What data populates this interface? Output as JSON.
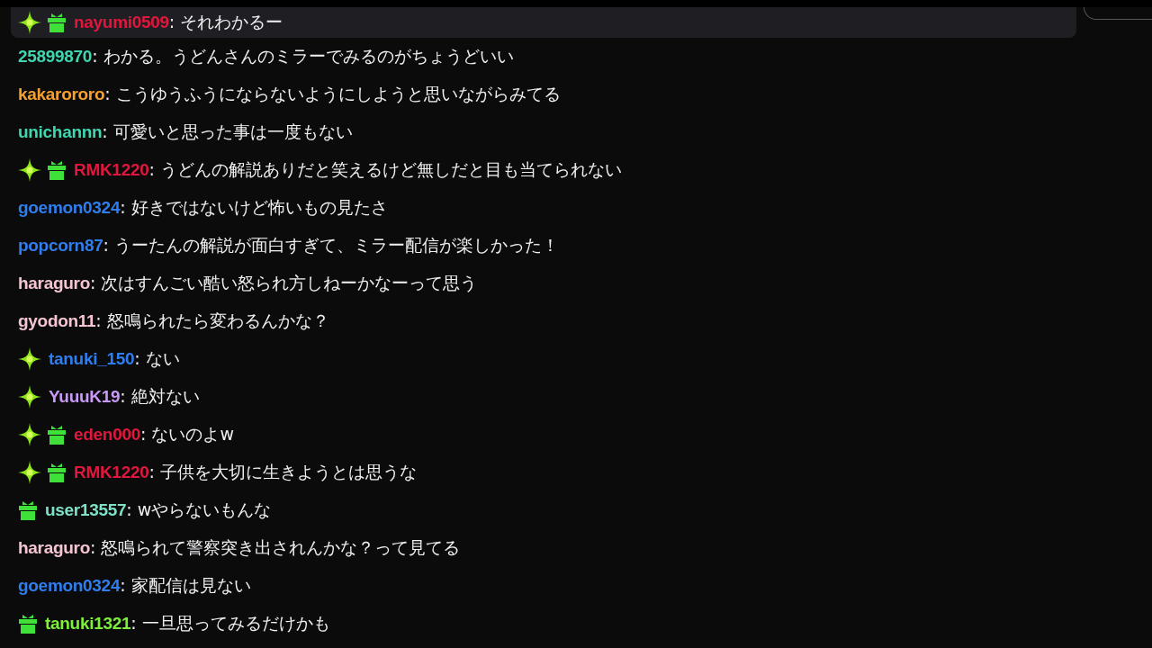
{
  "messages": [
    {
      "user": "nayumi0509",
      "color": "#e0173d",
      "sparkle_badge": true,
      "gift_badge": true,
      "text": ": それわかるー",
      "highlighted": true
    },
    {
      "user": "25899870",
      "color": "#3fd6b0",
      "sparkle_badge": false,
      "gift_badge": false,
      "text": ": わかる。うどんさんのミラーでみるのがちょうどいい",
      "highlighted": false
    },
    {
      "user": "kakarororo",
      "color": "#f5a030",
      "sparkle_badge": false,
      "gift_badge": false,
      "text": ": こうゆうふうにならないようにしようと思いながらみてる",
      "highlighted": false
    },
    {
      "user": "unichannn",
      "color": "#3fd6b0",
      "sparkle_badge": false,
      "gift_badge": false,
      "text": ": 可愛いと思った事は一度もない",
      "highlighted": false
    },
    {
      "user": "RMK1220",
      "color": "#e0173d",
      "sparkle_badge": true,
      "gift_badge": true,
      "text": ": うどんの解説ありだと笑えるけど無しだと目も当てられない",
      "highlighted": false
    },
    {
      "user": "goemon0324",
      "color": "#2f7ef0",
      "sparkle_badge": false,
      "gift_badge": false,
      "text": ": 好きではないけど怖いもの見たさ",
      "highlighted": false
    },
    {
      "user": "popcorn87",
      "color": "#2f7ef0",
      "sparkle_badge": false,
      "gift_badge": false,
      "text": ": うーたんの解説が面白すぎて、ミラー配信が楽しかった！",
      "highlighted": false
    },
    {
      "user": "haraguro",
      "color": "#f5c6d2",
      "sparkle_badge": false,
      "gift_badge": false,
      "text": ": 次はすんごい酷い怒られ方しねーかなーって思う",
      "highlighted": false
    },
    {
      "user": "gyodon11",
      "color": "#f5c6d2",
      "sparkle_badge": false,
      "gift_badge": false,
      "text": ": 怒鳴られたら変わるんかな？",
      "highlighted": false
    },
    {
      "user": "tanuki_150",
      "color": "#2f7ef0",
      "sparkle_badge": true,
      "gift_badge": false,
      "text": ": ない",
      "highlighted": false
    },
    {
      "user": "YuuuK19",
      "color": "#c89af5",
      "sparkle_badge": true,
      "gift_badge": false,
      "text": ": 絶対ない",
      "highlighted": false
    },
    {
      "user": "eden000",
      "color": "#e0173d",
      "sparkle_badge": true,
      "gift_badge": true,
      "text": ": ないのよw",
      "highlighted": false
    },
    {
      "user": "RMK1220",
      "color": "#e0173d",
      "sparkle_badge": true,
      "gift_badge": true,
      "text": ": 子供を大切に生きようとは思うな",
      "highlighted": false
    },
    {
      "user": "user13557",
      "color": "#7fe0c8",
      "sparkle_badge": false,
      "gift_badge": true,
      "text": ": wやらないもんな",
      "highlighted": false
    },
    {
      "user": "haraguro",
      "color": "#f5c6d2",
      "sparkle_badge": false,
      "gift_badge": false,
      "text": ": 怒鳴られて警察突き出されんかな？って見てる",
      "highlighted": false
    },
    {
      "user": "goemon0324",
      "color": "#2f7ef0",
      "sparkle_badge": false,
      "gift_badge": false,
      "text": ": 家配信は見ない",
      "highlighted": false
    },
    {
      "user": "tanuki1321",
      "color": "#7cf03a",
      "sparkle_badge": false,
      "gift_badge": true,
      "text": ": 一旦思ってみるだけかも",
      "highlighted": false
    }
  ]
}
